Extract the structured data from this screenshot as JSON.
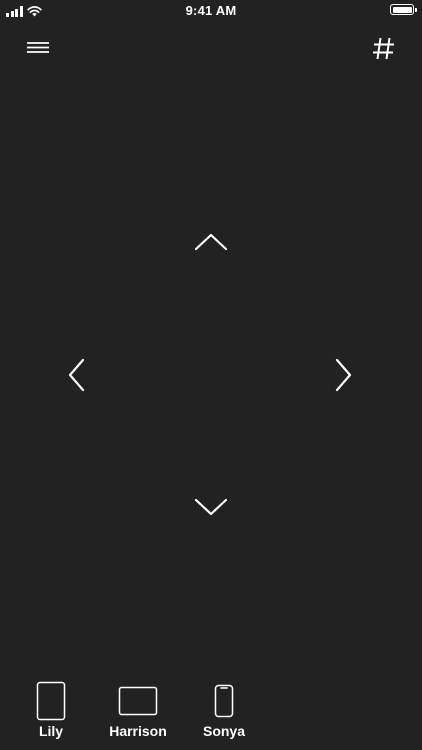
{
  "status_bar": {
    "time": "9:41 AM",
    "icons": [
      "signal-icon",
      "wifi-icon",
      "battery-icon"
    ]
  },
  "header": {
    "menu_icon": "hamburger-menu-icon",
    "keypad_icon": "hash-icon"
  },
  "dpad": {
    "up_icon": "chevron-up-icon",
    "down_icon": "chevron-down-icon",
    "left_icon": "chevron-left-icon",
    "right_icon": "chevron-right-icon"
  },
  "devices": [
    {
      "label": "Lily",
      "icon": "tablet-icon"
    },
    {
      "label": "Harrison",
      "icon": "tv-icon"
    },
    {
      "label": "Sonya",
      "icon": "phone-icon"
    }
  ],
  "colors": {
    "background": "#222222",
    "foreground": "#ffffff"
  }
}
